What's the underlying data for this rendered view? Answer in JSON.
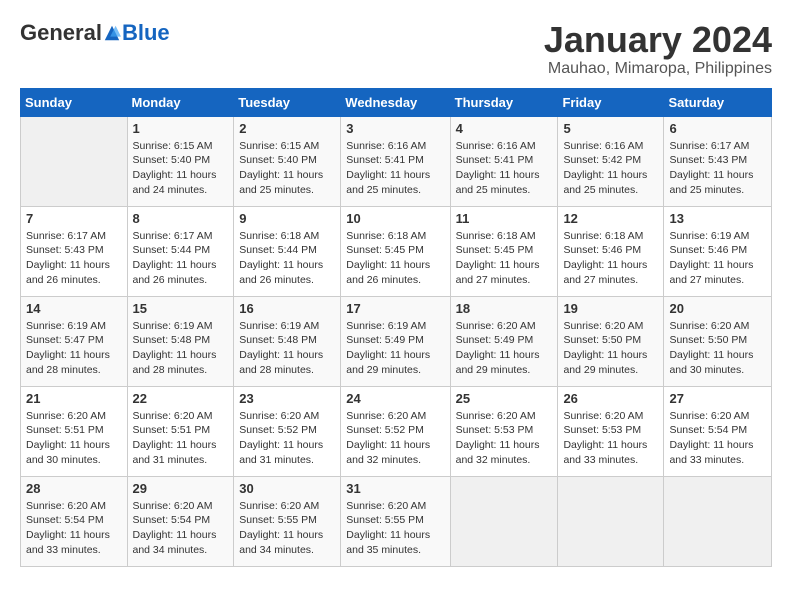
{
  "header": {
    "logo_general": "General",
    "logo_blue": "Blue",
    "month_title": "January 2024",
    "subtitle": "Mauhao, Mimaropa, Philippines"
  },
  "days_of_week": [
    "Sunday",
    "Monday",
    "Tuesday",
    "Wednesday",
    "Thursday",
    "Friday",
    "Saturday"
  ],
  "weeks": [
    [
      {
        "day": "",
        "sunrise": "",
        "sunset": "",
        "daylight": "",
        "empty": true
      },
      {
        "day": "1",
        "sunrise": "Sunrise: 6:15 AM",
        "sunset": "Sunset: 5:40 PM",
        "daylight": "Daylight: 11 hours and 24 minutes."
      },
      {
        "day": "2",
        "sunrise": "Sunrise: 6:15 AM",
        "sunset": "Sunset: 5:40 PM",
        "daylight": "Daylight: 11 hours and 25 minutes."
      },
      {
        "day": "3",
        "sunrise": "Sunrise: 6:16 AM",
        "sunset": "Sunset: 5:41 PM",
        "daylight": "Daylight: 11 hours and 25 minutes."
      },
      {
        "day": "4",
        "sunrise": "Sunrise: 6:16 AM",
        "sunset": "Sunset: 5:41 PM",
        "daylight": "Daylight: 11 hours and 25 minutes."
      },
      {
        "day": "5",
        "sunrise": "Sunrise: 6:16 AM",
        "sunset": "Sunset: 5:42 PM",
        "daylight": "Daylight: 11 hours and 25 minutes."
      },
      {
        "day": "6",
        "sunrise": "Sunrise: 6:17 AM",
        "sunset": "Sunset: 5:43 PM",
        "daylight": "Daylight: 11 hours and 25 minutes."
      }
    ],
    [
      {
        "day": "7",
        "sunrise": "Sunrise: 6:17 AM",
        "sunset": "Sunset: 5:43 PM",
        "daylight": "Daylight: 11 hours and 26 minutes."
      },
      {
        "day": "8",
        "sunrise": "Sunrise: 6:17 AM",
        "sunset": "Sunset: 5:44 PM",
        "daylight": "Daylight: 11 hours and 26 minutes."
      },
      {
        "day": "9",
        "sunrise": "Sunrise: 6:18 AM",
        "sunset": "Sunset: 5:44 PM",
        "daylight": "Daylight: 11 hours and 26 minutes."
      },
      {
        "day": "10",
        "sunrise": "Sunrise: 6:18 AM",
        "sunset": "Sunset: 5:45 PM",
        "daylight": "Daylight: 11 hours and 26 minutes."
      },
      {
        "day": "11",
        "sunrise": "Sunrise: 6:18 AM",
        "sunset": "Sunset: 5:45 PM",
        "daylight": "Daylight: 11 hours and 27 minutes."
      },
      {
        "day": "12",
        "sunrise": "Sunrise: 6:18 AM",
        "sunset": "Sunset: 5:46 PM",
        "daylight": "Daylight: 11 hours and 27 minutes."
      },
      {
        "day": "13",
        "sunrise": "Sunrise: 6:19 AM",
        "sunset": "Sunset: 5:46 PM",
        "daylight": "Daylight: 11 hours and 27 minutes."
      }
    ],
    [
      {
        "day": "14",
        "sunrise": "Sunrise: 6:19 AM",
        "sunset": "Sunset: 5:47 PM",
        "daylight": "Daylight: 11 hours and 28 minutes."
      },
      {
        "day": "15",
        "sunrise": "Sunrise: 6:19 AM",
        "sunset": "Sunset: 5:48 PM",
        "daylight": "Daylight: 11 hours and 28 minutes."
      },
      {
        "day": "16",
        "sunrise": "Sunrise: 6:19 AM",
        "sunset": "Sunset: 5:48 PM",
        "daylight": "Daylight: 11 hours and 28 minutes."
      },
      {
        "day": "17",
        "sunrise": "Sunrise: 6:19 AM",
        "sunset": "Sunset: 5:49 PM",
        "daylight": "Daylight: 11 hours and 29 minutes."
      },
      {
        "day": "18",
        "sunrise": "Sunrise: 6:20 AM",
        "sunset": "Sunset: 5:49 PM",
        "daylight": "Daylight: 11 hours and 29 minutes."
      },
      {
        "day": "19",
        "sunrise": "Sunrise: 6:20 AM",
        "sunset": "Sunset: 5:50 PM",
        "daylight": "Daylight: 11 hours and 29 minutes."
      },
      {
        "day": "20",
        "sunrise": "Sunrise: 6:20 AM",
        "sunset": "Sunset: 5:50 PM",
        "daylight": "Daylight: 11 hours and 30 minutes."
      }
    ],
    [
      {
        "day": "21",
        "sunrise": "Sunrise: 6:20 AM",
        "sunset": "Sunset: 5:51 PM",
        "daylight": "Daylight: 11 hours and 30 minutes."
      },
      {
        "day": "22",
        "sunrise": "Sunrise: 6:20 AM",
        "sunset": "Sunset: 5:51 PM",
        "daylight": "Daylight: 11 hours and 31 minutes."
      },
      {
        "day": "23",
        "sunrise": "Sunrise: 6:20 AM",
        "sunset": "Sunset: 5:52 PM",
        "daylight": "Daylight: 11 hours and 31 minutes."
      },
      {
        "day": "24",
        "sunrise": "Sunrise: 6:20 AM",
        "sunset": "Sunset: 5:52 PM",
        "daylight": "Daylight: 11 hours and 32 minutes."
      },
      {
        "day": "25",
        "sunrise": "Sunrise: 6:20 AM",
        "sunset": "Sunset: 5:53 PM",
        "daylight": "Daylight: 11 hours and 32 minutes."
      },
      {
        "day": "26",
        "sunrise": "Sunrise: 6:20 AM",
        "sunset": "Sunset: 5:53 PM",
        "daylight": "Daylight: 11 hours and 33 minutes."
      },
      {
        "day": "27",
        "sunrise": "Sunrise: 6:20 AM",
        "sunset": "Sunset: 5:54 PM",
        "daylight": "Daylight: 11 hours and 33 minutes."
      }
    ],
    [
      {
        "day": "28",
        "sunrise": "Sunrise: 6:20 AM",
        "sunset": "Sunset: 5:54 PM",
        "daylight": "Daylight: 11 hours and 33 minutes."
      },
      {
        "day": "29",
        "sunrise": "Sunrise: 6:20 AM",
        "sunset": "Sunset: 5:54 PM",
        "daylight": "Daylight: 11 hours and 34 minutes."
      },
      {
        "day": "30",
        "sunrise": "Sunrise: 6:20 AM",
        "sunset": "Sunset: 5:55 PM",
        "daylight": "Daylight: 11 hours and 34 minutes."
      },
      {
        "day": "31",
        "sunrise": "Sunrise: 6:20 AM",
        "sunset": "Sunset: 5:55 PM",
        "daylight": "Daylight: 11 hours and 35 minutes."
      },
      {
        "day": "",
        "sunrise": "",
        "sunset": "",
        "daylight": "",
        "empty": true
      },
      {
        "day": "",
        "sunrise": "",
        "sunset": "",
        "daylight": "",
        "empty": true
      },
      {
        "day": "",
        "sunrise": "",
        "sunset": "",
        "daylight": "",
        "empty": true
      }
    ]
  ]
}
